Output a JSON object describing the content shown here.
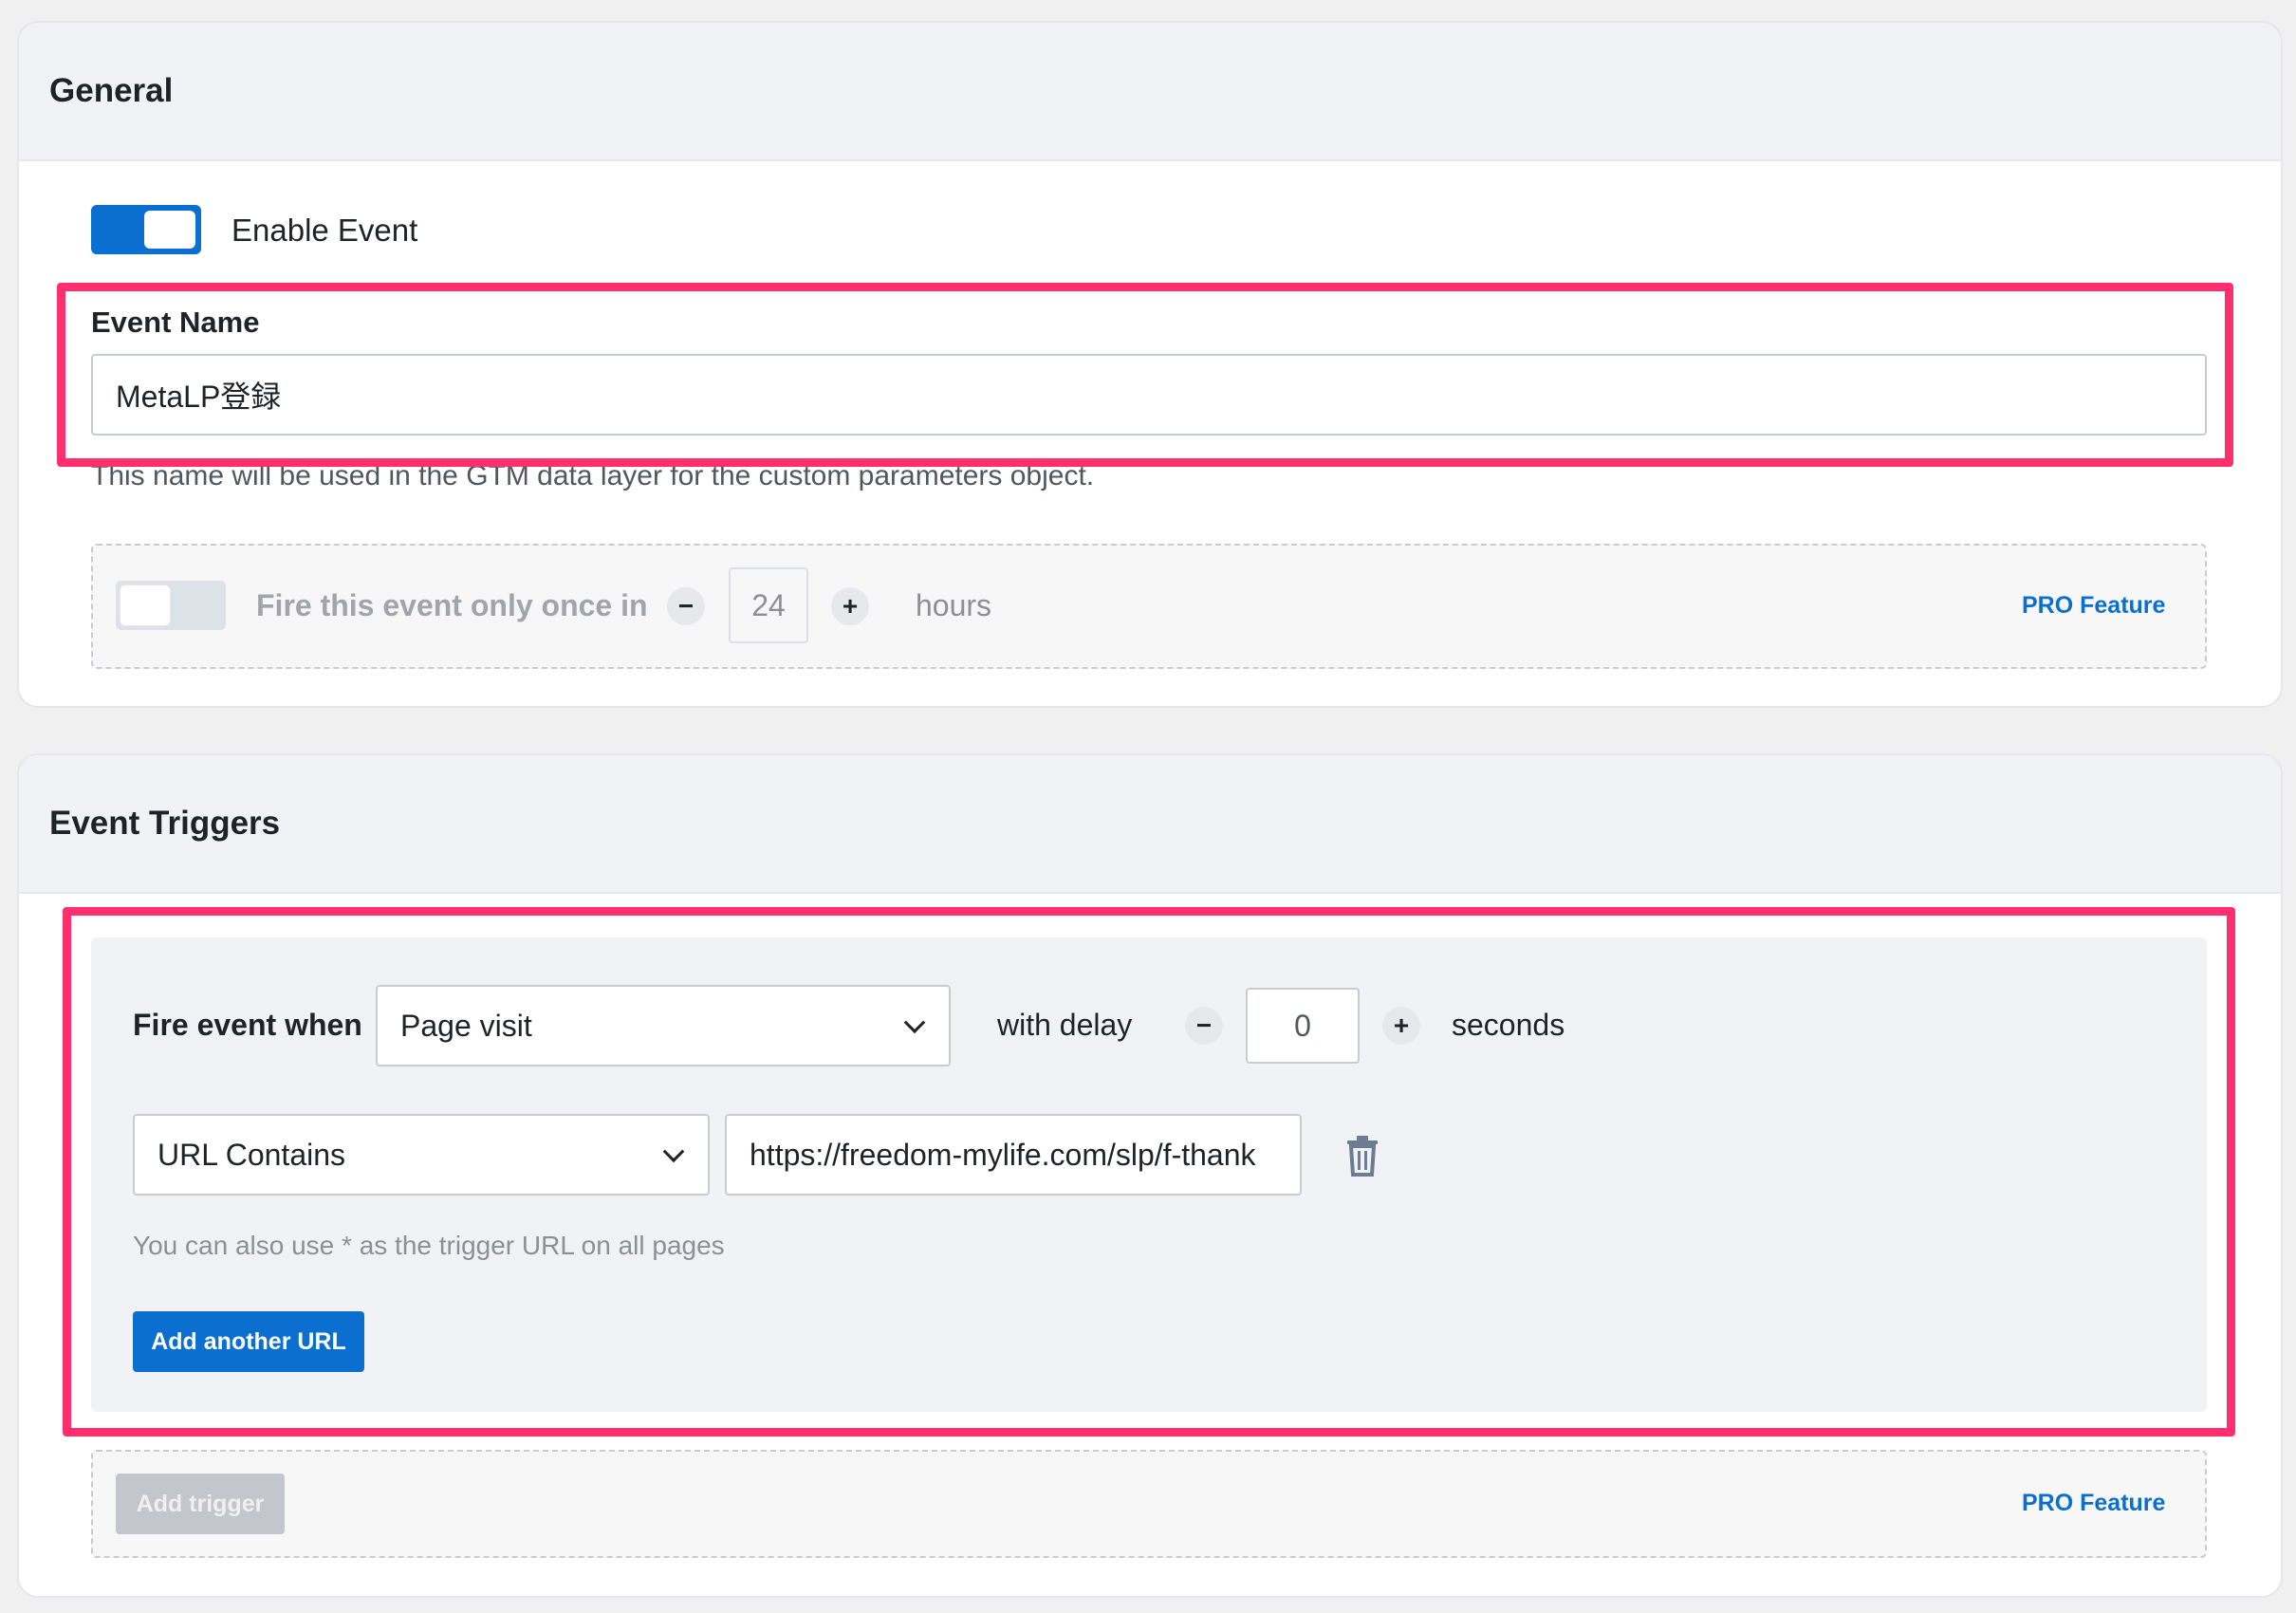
{
  "general": {
    "title": "General",
    "enable_event_label": "Enable Event",
    "enable_event_on": true,
    "event_name_label": "Event Name",
    "event_name_value": "MetaLP登録",
    "event_name_help": "This name will be used in the GTM data layer for the custom parameters object.",
    "fire_once": {
      "label": "Fire this event only once in",
      "value": "24",
      "unit": "hours",
      "minus": "−",
      "plus": "+",
      "pro_label": "PRO Feature",
      "enabled": false
    }
  },
  "triggers": {
    "title": "Event Triggers",
    "fire_when_label": "Fire event when",
    "fire_when_value": "Page visit",
    "with_delay_label": "with delay",
    "delay_value": "0",
    "delay_unit": "seconds",
    "minus": "−",
    "plus": "+",
    "url_condition_value": "URL Contains",
    "url_value": "https://freedom-mylife.com/slp/f-thank",
    "url_help": "You can also use * as the trigger URL on all pages",
    "add_url_label": "Add another URL",
    "add_trigger_label": "Add trigger",
    "pro_label": "PRO Feature"
  },
  "colors": {
    "accent": "#0a6fcf",
    "highlight": "#ff2f6e",
    "panel": "#f1f2f6"
  }
}
